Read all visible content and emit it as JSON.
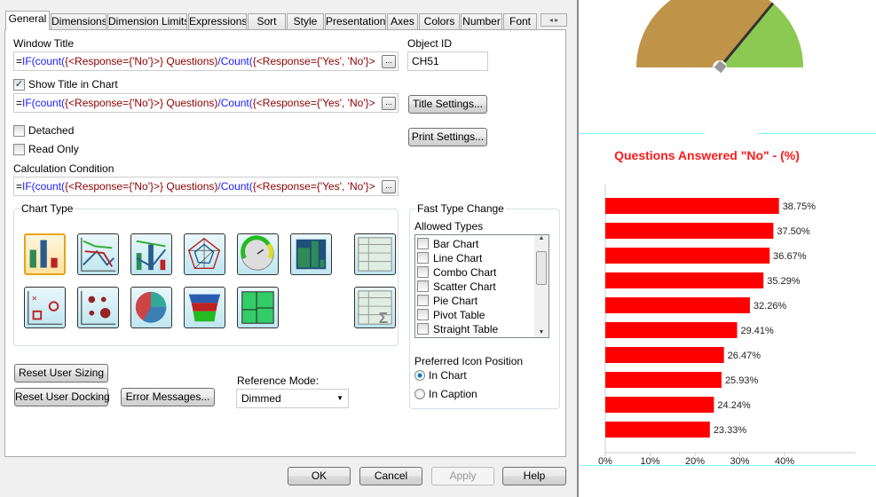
{
  "tabs": [
    "General",
    "Dimensions",
    "Dimension Limits",
    "Expressions",
    "Sort",
    "Style",
    "Presentation",
    "Axes",
    "Colors",
    "Number",
    "Font"
  ],
  "general": {
    "window_title_label": "Window Title",
    "expression_segments": [
      {
        "t": "=",
        "c": ""
      },
      {
        "t": "IF(count(",
        "c": "kw"
      },
      {
        "t": "{<Response={'No'}>} Questions)",
        "c": "sa"
      },
      {
        "t": "/Count(",
        "c": "kw"
      },
      {
        "t": "{<Response={'Yes', 'No'}>",
        "c": "sa"
      }
    ],
    "ellipsis": "...",
    "object_id_label": "Object ID",
    "object_id": "CH51",
    "show_title_label": "Show Title in Chart",
    "show_title_checked": true,
    "title_settings": "Title Settings...",
    "print_settings": "Print Settings...",
    "detached": "Detached",
    "read_only": "Read Only",
    "calc_condition_label": "Calculation Condition",
    "chart_type_label": "Chart Type",
    "fast_type_label": "Fast Type Change",
    "allowed_types_label": "Allowed Types",
    "allowed_types": [
      "Bar Chart",
      "Line Chart",
      "Combo Chart",
      "Scatter Chart",
      "Pie Chart",
      "Pivot Table",
      "Straight Table"
    ],
    "icon_position_label": "Preferred Icon Position",
    "in_chart": "In Chart",
    "in_caption": "In Caption",
    "reset_sizing": "Reset User Sizing",
    "reset_docking": "Reset User Docking",
    "error_messages": "Error Messages...",
    "reference_mode_label": "Reference Mode:",
    "reference_mode": "Dimmed"
  },
  "footer": {
    "ok": "OK",
    "cancel": "Cancel",
    "apply": "Apply",
    "help": "Help"
  },
  "gauge": {
    "value_fraction": 0.72,
    "colors": {
      "low": "#c09448",
      "high": "#8bc952"
    }
  },
  "chart_data": {
    "type": "bar",
    "orientation": "horizontal",
    "title": "Questions Answered \"No\" - (%)",
    "values": [
      38.75,
      37.5,
      36.67,
      35.29,
      32.26,
      29.41,
      26.47,
      25.93,
      24.24,
      23.33
    ],
    "labels": [
      "38.75%",
      "37.50%",
      "36.67%",
      "35.29%",
      "32.26%",
      "29.41%",
      "26.47%",
      "25.93%",
      "24.24%",
      "23.33%"
    ],
    "xticks": [
      "0%",
      "10%",
      "20%",
      "30%",
      "40%"
    ],
    "xlim": [
      0,
      55
    ],
    "bar_color": "#ff0000",
    "title_color": "#ff1a1a"
  }
}
